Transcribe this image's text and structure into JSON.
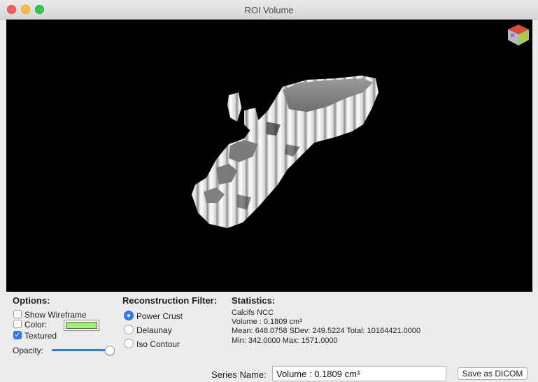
{
  "window": {
    "title": "ROI Volume"
  },
  "options": {
    "heading": "Options:",
    "show_wireframe": {
      "label": "Show Wireframe",
      "checked": false
    },
    "color": {
      "label": "Color:",
      "checked": false,
      "swatch": "#9cf06b"
    },
    "textured": {
      "label": "Textured",
      "checked": true
    },
    "opacity": {
      "label": "Opacity:",
      "value": 1.0
    }
  },
  "reconstruction": {
    "heading": "Reconstruction Filter:",
    "items": [
      {
        "label": "Power Crust",
        "selected": true
      },
      {
        "label": "Delaunay",
        "selected": false
      },
      {
        "label": "Iso Contour",
        "selected": false
      }
    ]
  },
  "statistics": {
    "heading": "Statistics:",
    "lines": [
      "Calcifs NCC",
      "Volume : 0.1809 cm³",
      "Mean: 648.0758 SDev: 249.5224 Total: 10164421.0000",
      "Min: 342.0000 Max: 1571.0000"
    ]
  },
  "series": {
    "label": "Series Name:",
    "value": "Volume : 0.1809 cm³"
  },
  "buttons": {
    "save_dicom": "Save  as DICOM"
  },
  "colors": {
    "viewport_bg": "#000000",
    "accent": "#2f7bf5"
  },
  "icons": {
    "orientation_cube": "orientation-cube-icon"
  }
}
